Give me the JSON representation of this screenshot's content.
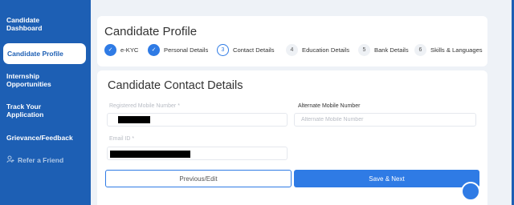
{
  "sidebar": {
    "items": [
      {
        "label": "Candidate\nDashboard"
      },
      {
        "label": "Candidate Profile"
      },
      {
        "label": "Internship\nOpportunities"
      },
      {
        "label": "Track Your\nApplication"
      },
      {
        "label": "Grievance/Feedback"
      },
      {
        "label": "Refer a Friend",
        "icon": "user-plus-icon"
      }
    ],
    "active_index": 1
  },
  "profile": {
    "title": "Candidate Profile",
    "steps": [
      {
        "marker": "✓",
        "label": "e-KYC",
        "status": "done"
      },
      {
        "marker": "✓",
        "label": "Personal Details",
        "status": "done"
      },
      {
        "marker": "3",
        "label": "Contact Details",
        "status": "current"
      },
      {
        "marker": "4",
        "label": "Education Details",
        "status": "todo"
      },
      {
        "marker": "5",
        "label": "Bank Details",
        "status": "todo"
      },
      {
        "marker": "6",
        "label": "Skills & Languages",
        "status": "todo"
      }
    ]
  },
  "contact": {
    "title": "Candidate Contact Details",
    "mobile_label": "Registered Mobile Number *",
    "alt_mobile_label": "Alternate Mobile Number",
    "alt_mobile_placeholder": "Alternate Mobile Number",
    "email_label": "Email ID *",
    "previous_label": "Previous/Edit",
    "save_label": "Save & Next"
  },
  "colors": {
    "brand": "#1d5fb4",
    "accent": "#2f7be5"
  }
}
